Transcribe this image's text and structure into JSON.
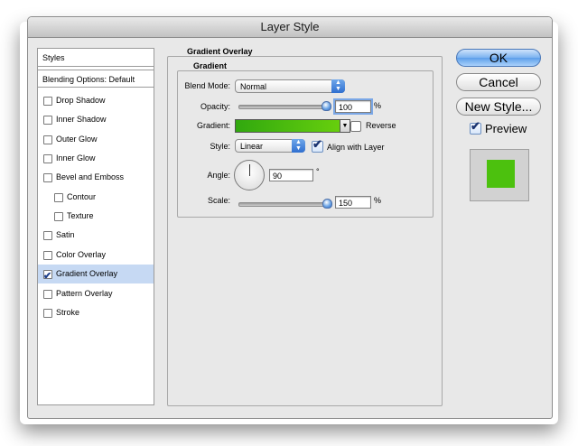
{
  "window": {
    "title": "Layer Style"
  },
  "styles_panel": {
    "header": "Styles",
    "blending": "Blending Options: Default",
    "items": [
      {
        "label": "Drop Shadow",
        "checked": false,
        "indent": 0
      },
      {
        "label": "Inner Shadow",
        "checked": false,
        "indent": 0
      },
      {
        "label": "Outer Glow",
        "checked": false,
        "indent": 0
      },
      {
        "label": "Inner Glow",
        "checked": false,
        "indent": 0
      },
      {
        "label": "Bevel and Emboss",
        "checked": false,
        "indent": 0
      },
      {
        "label": "Contour",
        "checked": false,
        "indent": 1
      },
      {
        "label": "Texture",
        "checked": false,
        "indent": 1
      },
      {
        "label": "Satin",
        "checked": false,
        "indent": 0
      },
      {
        "label": "Color Overlay",
        "checked": false,
        "indent": 0
      },
      {
        "label": "Gradient Overlay",
        "checked": true,
        "indent": 0,
        "selected": true
      },
      {
        "label": "Pattern Overlay",
        "checked": false,
        "indent": 0
      },
      {
        "label": "Stroke",
        "checked": false,
        "indent": 0
      }
    ]
  },
  "section": {
    "title": "Gradient Overlay",
    "subtitle": "Gradient"
  },
  "fields": {
    "blend_mode": {
      "label": "Blend Mode:",
      "value": "Normal"
    },
    "opacity": {
      "label": "Opacity:",
      "value": "100",
      "unit": "%"
    },
    "gradient": {
      "label": "Gradient:",
      "colors": [
        "#31a80f",
        "#67cf0d"
      ]
    },
    "reverse": {
      "label": "Reverse",
      "checked": false
    },
    "style": {
      "label": "Style:",
      "value": "Linear"
    },
    "align": {
      "label": "Align with Layer",
      "checked": true
    },
    "angle": {
      "label": "Angle:",
      "value": "90",
      "unit": "°"
    },
    "scale": {
      "label": "Scale:",
      "value": "150",
      "unit": "%"
    }
  },
  "buttons": {
    "ok": "OK",
    "cancel": "Cancel",
    "new_style": "New Style..."
  },
  "preview": {
    "label": "Preview",
    "checked": true,
    "swatch_color": "#4cc10e"
  }
}
